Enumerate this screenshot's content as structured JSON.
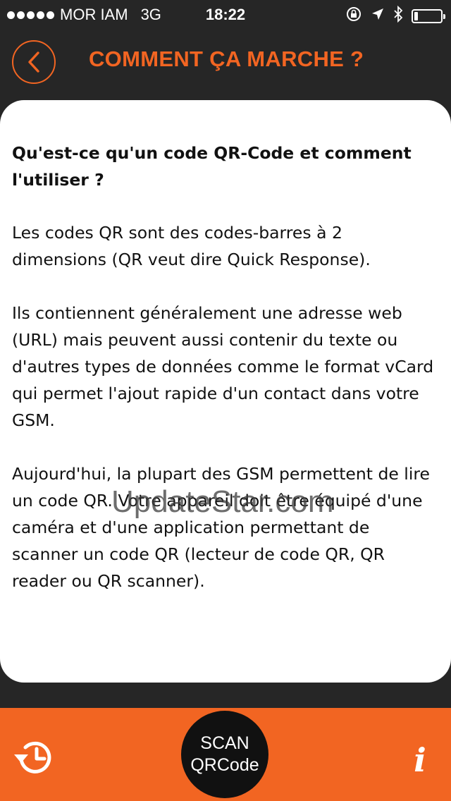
{
  "status_bar": {
    "carrier": "MOR IAM",
    "network": "3G",
    "time": "18:22",
    "icons": [
      "rotation-lock-icon",
      "location-arrow-icon",
      "bluetooth-icon",
      "battery-icon"
    ],
    "battery_level": 0.15
  },
  "header": {
    "back_icon": "chevron-left-icon",
    "title": "COMMENT ÇA MARCHE ?"
  },
  "content": {
    "question": "Qu'est-ce qu'un code QR-Code et comment l'utiliser ?",
    "paragraphs": [
      "Les codes QR sont des codes-barres à 2 dimensions (QR veut dire Quick Response).",
      "Ils contiennent généralement une adresse web (URL) mais peuvent aussi contenir du texte ou d'autres types de données comme le format vCard qui permet l'ajout rapide d'un contact dans votre GSM.",
      "Aujourd'hui, la plupart des GSM permettent de lire un code QR. Votre appareil doit être équipé d'une caméra et d'une application permettant de scanner un code QR (lecteur de code QR, QR reader ou QR scanner)."
    ],
    "watermark": "UpdateStar.com"
  },
  "bottom_bar": {
    "history_icon": "history-icon",
    "scan_line1": "SCAN",
    "scan_line2": "QRCode",
    "info_label": "i"
  },
  "colors": {
    "accent": "#f26522",
    "background": "#262626",
    "card": "#ffffff",
    "scan_button": "#111111"
  }
}
